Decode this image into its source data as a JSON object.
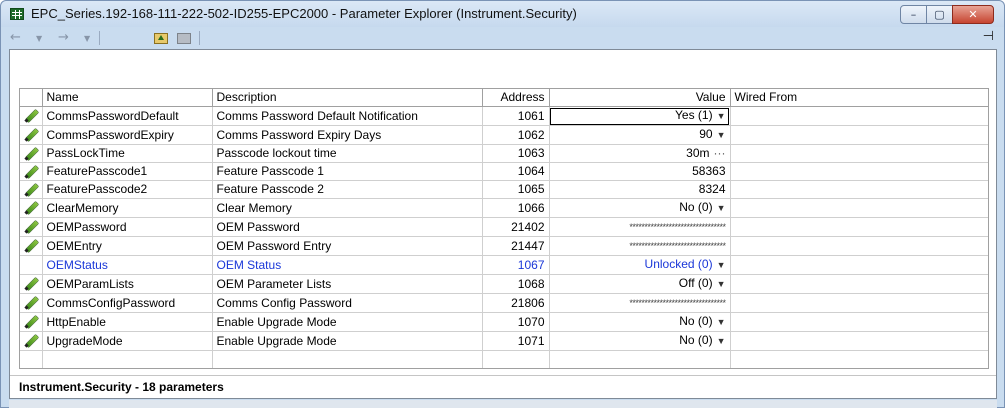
{
  "window": {
    "title": "EPC_Series.192-168-111-222-502-ID255-EPC2000 - Parameter Explorer (Instrument.Security)",
    "min_glyph": "–",
    "max_glyph": "▢",
    "close_glyph": "✕"
  },
  "toolbar": {
    "back_glyph": "←",
    "back_dd_glyph": "▼",
    "fwd_glyph": "→",
    "fwd_dd_glyph": "▼",
    "pin_glyph": "⊣"
  },
  "table": {
    "headers": {
      "name": "Name",
      "description": "Description",
      "address": "Address",
      "value": "Value",
      "wired_from": "Wired From"
    },
    "rows": [
      {
        "name": "CommsPasswordDefault",
        "description": "Comms Password Default Notification",
        "address": "1061",
        "value": "Yes (1)",
        "widget": "dropdown",
        "wired_from": ""
      },
      {
        "name": "CommsPasswordExpiry",
        "description": "Comms Password Expiry Days",
        "address": "1062",
        "value": "90",
        "widget": "dropdown",
        "wired_from": ""
      },
      {
        "name": "PassLockTime",
        "description": "Passcode lockout time",
        "address": "1063",
        "value": "30m",
        "widget": "ellipsis",
        "wired_from": ""
      },
      {
        "name": "FeaturePasscode1",
        "description": "Feature Passcode 1",
        "address": "1064",
        "value": "58363",
        "widget": "",
        "wired_from": ""
      },
      {
        "name": "FeaturePasscode2",
        "description": "Feature Passcode 2",
        "address": "1065",
        "value": "8324",
        "widget": "",
        "wired_from": ""
      },
      {
        "name": "ClearMemory",
        "description": "Clear Memory",
        "address": "1066",
        "value": "No (0)",
        "widget": "dropdown",
        "wired_from": ""
      },
      {
        "name": "OEMPassword",
        "description": "OEM Password",
        "address": "21402",
        "value": "********************************",
        "widget": "masked",
        "wired_from": ""
      },
      {
        "name": "OEMEntry",
        "description": "OEM Password Entry",
        "address": "21447",
        "value": "********************************",
        "widget": "masked",
        "wired_from": ""
      },
      {
        "name": "OEMStatus",
        "description": "OEM Status",
        "address": "1067",
        "value": "Unlocked (0)",
        "widget": "dropdown",
        "wired_from": ""
      },
      {
        "name": "OEMParamLists",
        "description": "OEM Parameter Lists",
        "address": "1068",
        "value": "Off (0)",
        "widget": "dropdown",
        "wired_from": ""
      },
      {
        "name": "CommsConfigPassword",
        "description": "Comms Config Password",
        "address": "21806",
        "value": "********************************",
        "widget": "masked",
        "wired_from": ""
      },
      {
        "name": "HttpEnable",
        "description": "Enable Upgrade Mode",
        "address": "1070",
        "value": "No (0)",
        "widget": "dropdown",
        "wired_from": ""
      },
      {
        "name": "UpgradeMode",
        "description": "Enable Upgrade Mode",
        "address": "1071",
        "value": "No (0)",
        "widget": "dropdown",
        "wired_from": ""
      }
    ],
    "editable_icon": "pencil-icon",
    "readonly_color": "#1a37d8"
  },
  "status": {
    "text": "Instrument.Security  -  18 parameters"
  }
}
